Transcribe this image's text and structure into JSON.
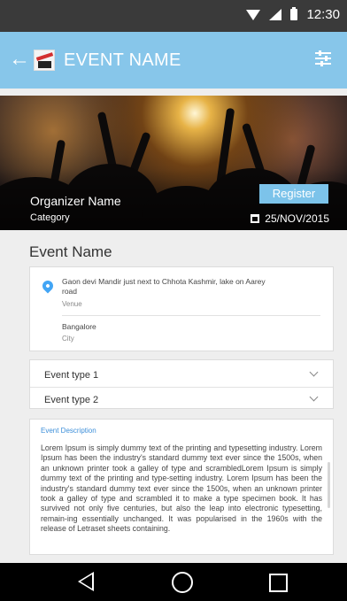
{
  "status_bar": {
    "time": "12:30",
    "icons": [
      "wifi-icon",
      "signal-icon",
      "battery-icon"
    ]
  },
  "app_bar": {
    "title": "EVENT NAME",
    "back_icon": "back-arrow-icon",
    "menu_icon": "filter-icon"
  },
  "hero": {
    "organizer_name": "Organizer Name",
    "category": "Category",
    "register_label": "Register",
    "date": "25/NOV/2015"
  },
  "event": {
    "name": "Event Name"
  },
  "venue": {
    "address": "Gaon devi Mandir just next to Chhota Kashmir, lake on Aarey road",
    "venue_label": "Venue",
    "city": "Bangalore",
    "city_label": "City"
  },
  "event_types": [
    {
      "label": "Event type 1"
    },
    {
      "label": "Event type 2"
    }
  ],
  "description": {
    "title": "Event Description",
    "body": "Lorem Ipsum is simply dummy text of the printing and typesetting industry. Lorem Ipsum has been the industry's standard dummy text ever since the 1500s, when an unknown printer took a galley of type and scrambledLorem Ipsum is simply dummy text of the printing and type-setting industry. Lorem Ipsum has been the industry's standard dummy text ever since the 1500s, when an unknown printer took a galley of type and scrambled it to make a type specimen book. It has survived not only five centuries, but also the leap into electronic typesetting, remain-ing essentially unchanged. It was popularised in the 1960s with the release of Letraset sheets containing."
  },
  "colors": {
    "app_bar": "#87c6ea",
    "register_button": "#7cc3ea",
    "accent": "#3d8fd9",
    "status_bar": "#3a3a3a",
    "nav_bar": "#000000"
  }
}
